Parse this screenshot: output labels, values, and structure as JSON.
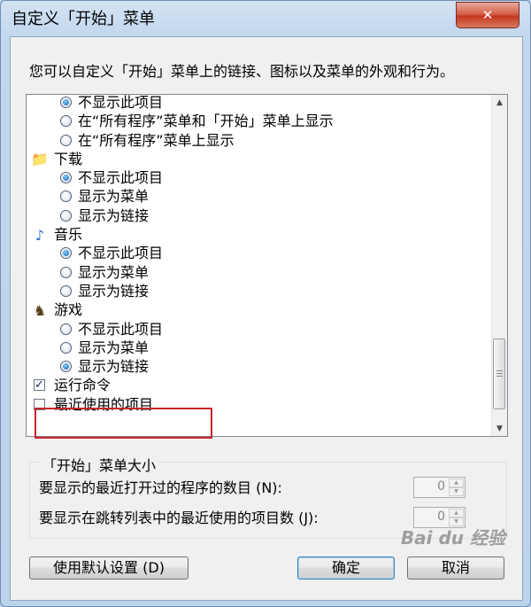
{
  "window": {
    "title": "自定义「开始」菜单",
    "close_glyph": "✕"
  },
  "description": "您可以自定义「开始」菜单上的链接、图标以及菜单的外观和行为。",
  "list": {
    "rows": [
      {
        "kind": "radio",
        "label": "不显示此项目",
        "checked": true
      },
      {
        "kind": "radio",
        "label": "在“所有程序”菜单和「开始」菜单上显示",
        "checked": false
      },
      {
        "kind": "radio",
        "label": "在“所有程序”菜单上显示",
        "checked": false
      },
      {
        "kind": "category",
        "label": "下载",
        "icon": "download-folder-icon",
        "glyph": "📁"
      },
      {
        "kind": "radio",
        "label": "不显示此项目",
        "checked": true
      },
      {
        "kind": "radio",
        "label": "显示为菜单",
        "checked": false
      },
      {
        "kind": "radio",
        "label": "显示为链接",
        "checked": false
      },
      {
        "kind": "category",
        "label": "音乐",
        "icon": "music-note-icon",
        "glyph": "♪"
      },
      {
        "kind": "radio",
        "label": "不显示此项目",
        "checked": true
      },
      {
        "kind": "radio",
        "label": "显示为菜单",
        "checked": false
      },
      {
        "kind": "radio",
        "label": "显示为链接",
        "checked": false
      },
      {
        "kind": "category",
        "label": "游戏",
        "icon": "games-chess-icon",
        "glyph": "♞"
      },
      {
        "kind": "radio",
        "label": "不显示此项目",
        "checked": false
      },
      {
        "kind": "radio",
        "label": "显示为菜单",
        "checked": false
      },
      {
        "kind": "radio",
        "label": "显示为链接",
        "checked": true
      },
      {
        "kind": "checkbox",
        "label": "运行命令",
        "checked": true
      },
      {
        "kind": "checkbox",
        "label": "最近使用的项目",
        "checked": false
      }
    ]
  },
  "size_group": {
    "title": "「开始」菜单大小",
    "recent_programs_label": "要显示的最近打开过的程序的数目 (N):",
    "recent_programs_value": "0",
    "jump_list_label": "要显示在跳转列表中的最近使用的项目数 (J):",
    "jump_list_value": "0"
  },
  "buttons": {
    "defaults": "使用默认设置 (D)",
    "ok": "确定",
    "cancel": "取消"
  },
  "watermark": "Bai du 经验"
}
